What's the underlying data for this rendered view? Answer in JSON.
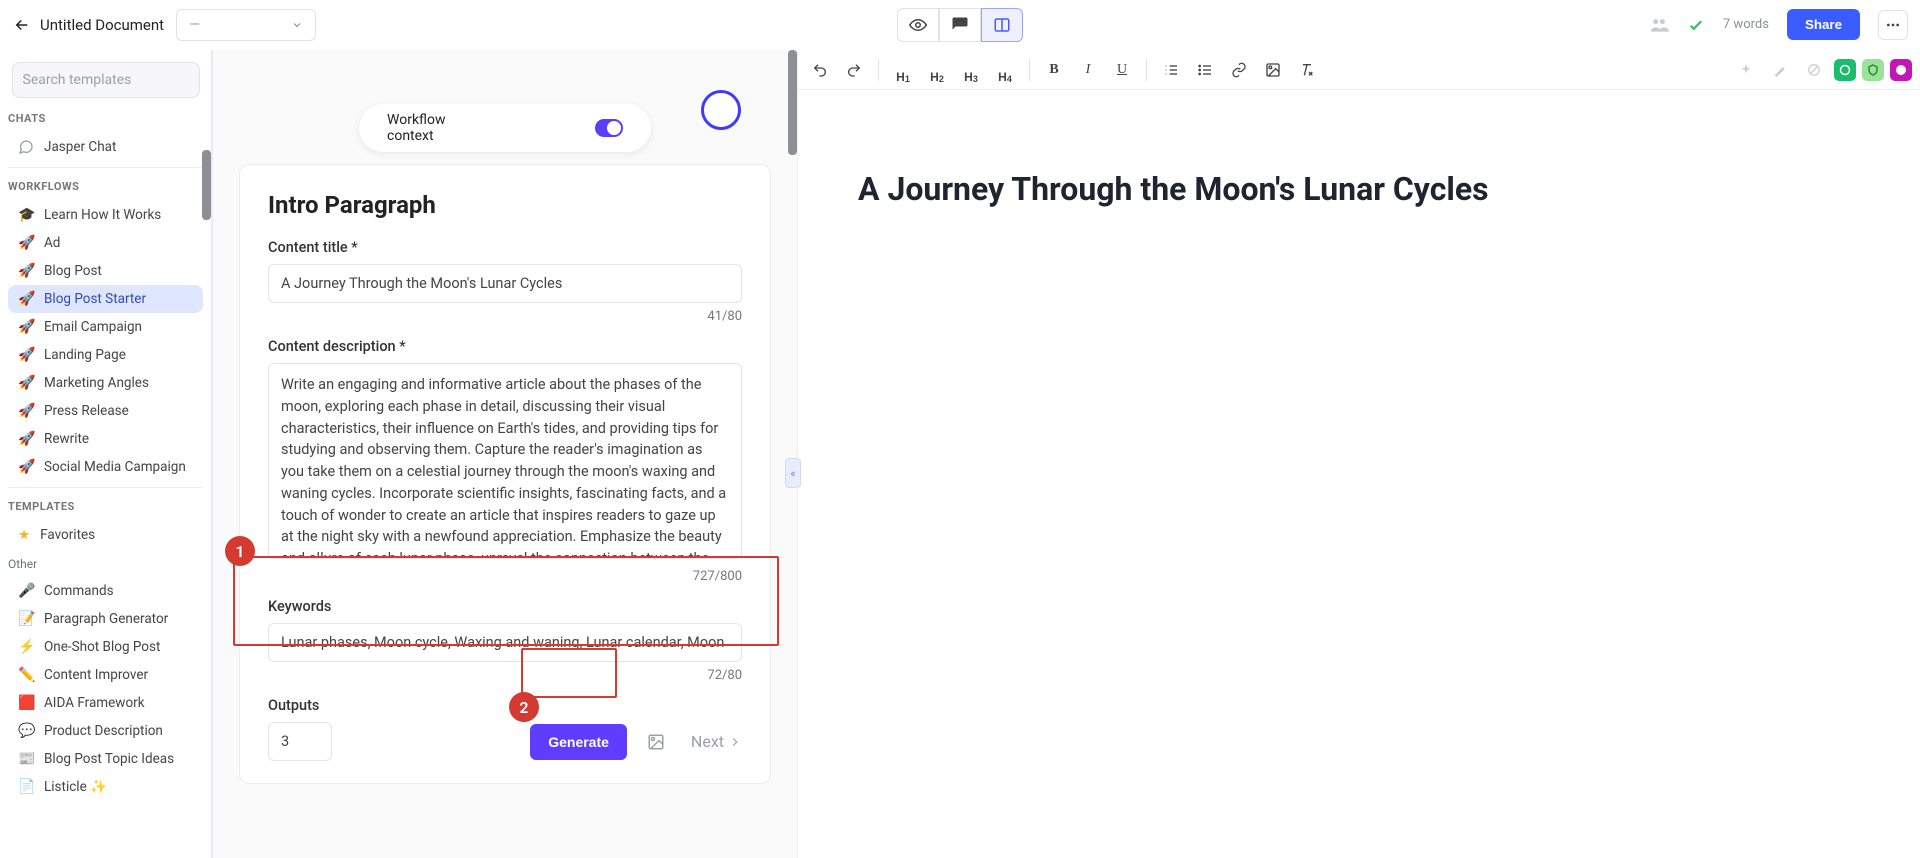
{
  "header": {
    "doc_title": "Untitled Document",
    "selector_value": "—",
    "word_count": "7 words",
    "share": "Share"
  },
  "sidebar": {
    "search_placeholder": "Search templates",
    "labels": {
      "chats": "CHATS",
      "workflows": "WORKFLOWS",
      "templates": "TEMPLATES",
      "other": "Other"
    },
    "chat": "Jasper Chat",
    "workflows": [
      "Learn How It Works",
      "Ad",
      "Blog Post",
      "Blog Post Starter",
      "Email Campaign",
      "Landing Page",
      "Marketing Angles",
      "Press Release",
      "Rewrite",
      "Social Media Campaign"
    ],
    "favorites": "Favorites",
    "templates": [
      "Commands",
      "Paragraph Generator",
      "One-Shot Blog Post",
      "Content Improver",
      "AIDA Framework",
      "Product Description",
      "Blog Post Topic Ideas",
      "Listicle ✨"
    ]
  },
  "form": {
    "workflow_context": "Workflow context",
    "title": "Intro Paragraph",
    "content_title_label": "Content title *",
    "content_title_value": "A Journey Through the Moon's Lunar Cycles",
    "content_title_count": "41/80",
    "desc_label": "Content description *",
    "desc_value": "Write an engaging and informative article about the phases of the moon, exploring each phase in detail, discussing their visual characteristics, their influence on Earth's tides, and providing tips for studying and observing them. Capture the reader's imagination as you take them on a celestial journey through the moon's waxing and waning cycles. Incorporate scientific insights, fascinating facts, and a touch of wonder to create an article that inspires readers to gaze up at the night sky with a newfound appreciation. Emphasize the beauty and allure of each lunar phase, unravel the connection between the moon and Earth's tides, and empower readers with practical advice on how to embark on their own lunar exploration.",
    "desc_count": "727/800",
    "keywords_label": "Keywords",
    "keywords_value": "Lunar phases, Moon cycle, Waxing and waning, Lunar calendar, Moon phases",
    "keywords_count": "72/80",
    "outputs_label": "Outputs",
    "outputs_value": "3",
    "generate": "Generate",
    "next": "Next"
  },
  "document": {
    "heading": "A Journey Through the Moon's Lunar Cycles"
  },
  "annotations": {
    "step1": "1",
    "step2": "2"
  }
}
